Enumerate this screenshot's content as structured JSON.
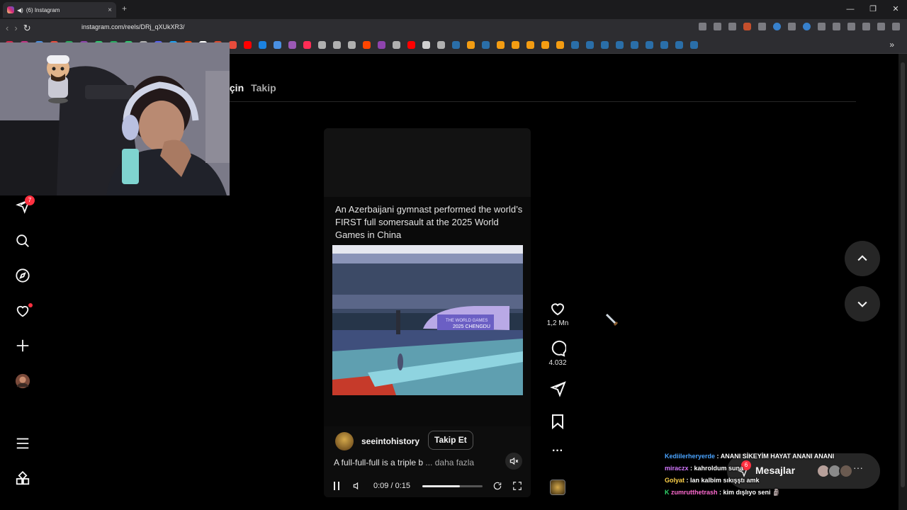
{
  "browser": {
    "tab_title": "(6) Instagram",
    "url": "instagram.com/reels/DRj_qXUkXR3/",
    "new_tab": "+",
    "tab_close": "×",
    "window_controls": [
      "—",
      "❐",
      "✕"
    ],
    "more_bookmarks": "»",
    "bookmark_colors": [
      "#d9284d",
      "#c13584",
      "#4a8fe0",
      "#e74c3c",
      "#27ae60",
      "#8e44ad",
      "#2ecc71",
      "#27ae60",
      "#2ecc71",
      "#b0b0b0",
      "#5865f2",
      "#1da1f2",
      "#ff4500",
      "#ffffff",
      "#e04a2b",
      "#e74c3c",
      "#ff0000",
      "#1b82e0",
      "#4a90e2",
      "#9b59b6",
      "#ff2d55",
      "#b0b0b0",
      "#b0b0b0",
      "#b0b0b0",
      "#ff4500",
      "#8e44ad",
      "#b0b0b0",
      "#ff0000",
      "#d0d0d0",
      "#b0b0b0",
      "#2a6ea8",
      "#f39c12",
      "#2a6ea8",
      "#f39c12",
      "#f39c12",
      "#f39c12",
      "#f39c12",
      "#f39c12",
      "#2a6ea8",
      "#2a6ea8",
      "#2a6ea8",
      "#2a6ea8",
      "#2a6ea8",
      "#2a6ea8",
      "#2a6ea8",
      "#2a6ea8",
      "#2a6ea8"
    ]
  },
  "instagram": {
    "tabs": [
      "İçin",
      "Takip"
    ],
    "sidebar_badge": "7",
    "reel": {
      "caption": "An Azerbaijani gymnast performed the world’s FIRST full somersault at the 2025 World Games in China",
      "venue_label_1": "THE WORLD GAMES",
      "venue_label_2": "2025 CHENGDU",
      "author": "seeintohistory",
      "follow_label": "Takip Et",
      "description": "A full-full-full is a triple b",
      "more_label": "... daha fazla",
      "time": "0:09 / 0:15",
      "progress": 0.62
    },
    "actions": {
      "likes": "1,2 Mn",
      "comments": "4.032",
      "more": "···"
    },
    "messages": {
      "label": "Mesajlar",
      "badge": "6",
      "more": "···"
    }
  },
  "chat": [
    {
      "user": "Kediilerheryerde",
      "text": "ANANI SİKEYİM HAYAT ANANI ANANI"
    },
    {
      "user": "miraczx",
      "text": "kahroldum suna"
    },
    {
      "user": "Golyat",
      "text": "lan kalbim sıkışştı amk"
    },
    {
      "user": "zumrutthetrash",
      "text": "kim dışlıyo seni 🗿"
    }
  ],
  "colors": {
    "accent_red": "#ff3040",
    "bg": "#000000"
  }
}
